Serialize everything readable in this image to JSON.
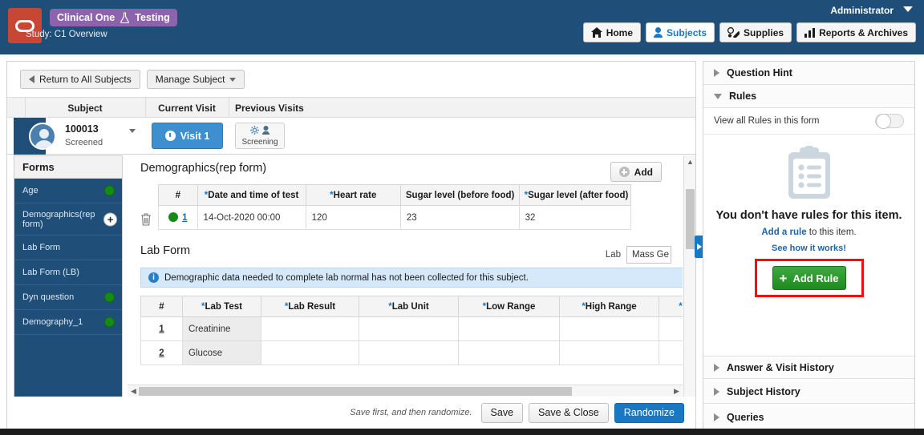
{
  "header": {
    "brand": "Clinical One",
    "environment": "Testing",
    "study_label": "Study: C1 Overview",
    "user": "Administrator",
    "nav": [
      {
        "label": "Home",
        "icon": "home-icon",
        "active": false
      },
      {
        "label": "Subjects",
        "icon": "user-icon",
        "active": true
      },
      {
        "label": "Supplies",
        "icon": "pills-icon",
        "active": false
      },
      {
        "label": "Reports & Archives",
        "icon": "bar-chart-icon",
        "active": false
      }
    ]
  },
  "toolbar": {
    "return_label": "Return to All Subjects",
    "manage_label": "Manage Subject"
  },
  "subject_bar": {
    "columns": [
      "Subject",
      "Current Visit",
      "Previous Visits"
    ],
    "subject_id": "100013",
    "subject_status": "Screened",
    "current_visit": "Visit 1",
    "previous_visits": [
      {
        "label": "Screening",
        "icons": [
          "gear-icon",
          "user-icon"
        ]
      }
    ]
  },
  "forms_pane": {
    "title": "Forms",
    "items": [
      {
        "label": "Demographics(rep form)",
        "status": "plus",
        "selected": true
      },
      {
        "label": "Age",
        "status": "green"
      },
      {
        "label": "Lab Form",
        "status": "none"
      },
      {
        "label": "Lab Form (LB)",
        "status": "none"
      },
      {
        "label": "Dyn question",
        "status": "green"
      },
      {
        "label": "Demography_1",
        "status": "green"
      }
    ],
    "order": [
      "Age",
      "Demographics(rep form)",
      "Lab Form",
      "Lab Form (LB)",
      "Dyn question",
      "Demography_1"
    ]
  },
  "demographics": {
    "title": "Demographics(rep form)",
    "add_label": "Add",
    "columns": [
      {
        "label": "#",
        "required": false
      },
      {
        "label": "Date and time of test",
        "required": true
      },
      {
        "label": "Heart rate",
        "required": true
      },
      {
        "label": "Sugar level (before food)",
        "required": false
      },
      {
        "label": "Sugar level (after food)",
        "required": true
      }
    ],
    "rows": [
      {
        "num": "1",
        "status": "green",
        "date_time": "14-Oct-2020 00:00",
        "heart_rate": "120",
        "sugar_before": "23",
        "sugar_after": "32"
      }
    ]
  },
  "lab_form": {
    "title": "Lab Form",
    "lab_label": "Lab",
    "lab_value": "Mass Ge",
    "info_message": "Demographic data needed to complete lab normal has not been collected for this subject.",
    "columns": [
      {
        "label": "#",
        "required": false
      },
      {
        "label": "Lab Test",
        "required": true
      },
      {
        "label": "Lab Result",
        "required": true
      },
      {
        "label": "Lab Unit",
        "required": true
      },
      {
        "label": "Low Range",
        "required": true
      },
      {
        "label": "High Range",
        "required": true
      },
      {
        "label": "",
        "required": true
      }
    ],
    "rows": [
      {
        "num": "1",
        "test": "Creatinine",
        "result": "",
        "unit": "",
        "low": "",
        "high": ""
      },
      {
        "num": "2",
        "test": "Glucose",
        "result": "",
        "unit": "",
        "low": "",
        "high": ""
      }
    ]
  },
  "footer": {
    "hint": "Save first, and then randomize.",
    "save": "Save",
    "save_close": "Save & Close",
    "randomize": "Randomize"
  },
  "right_panel": {
    "sections": [
      {
        "label": "Question Hint",
        "expanded": false
      },
      {
        "label": "Rules",
        "expanded": true
      },
      {
        "label": "Answer & Visit History",
        "expanded": false
      },
      {
        "label": "Subject History",
        "expanded": false
      },
      {
        "label": "Queries",
        "expanded": false
      }
    ],
    "view_all_rules_label": "View all Rules in this form",
    "toggle_state": "off",
    "empty_title": "You don't have rules for this item.",
    "empty_link": "Add a rule",
    "empty_suffix": " to this item.",
    "how_it_works": "See how it works!",
    "add_rule_button": "Add Rule"
  },
  "colors": {
    "header_blue": "#1f4e79",
    "brand_purple": "#8d63ad",
    "logo_red": "#c74634",
    "accent_blue": "#1878c4",
    "status_green": "#168b16",
    "highlight_red": "#ee1111"
  }
}
